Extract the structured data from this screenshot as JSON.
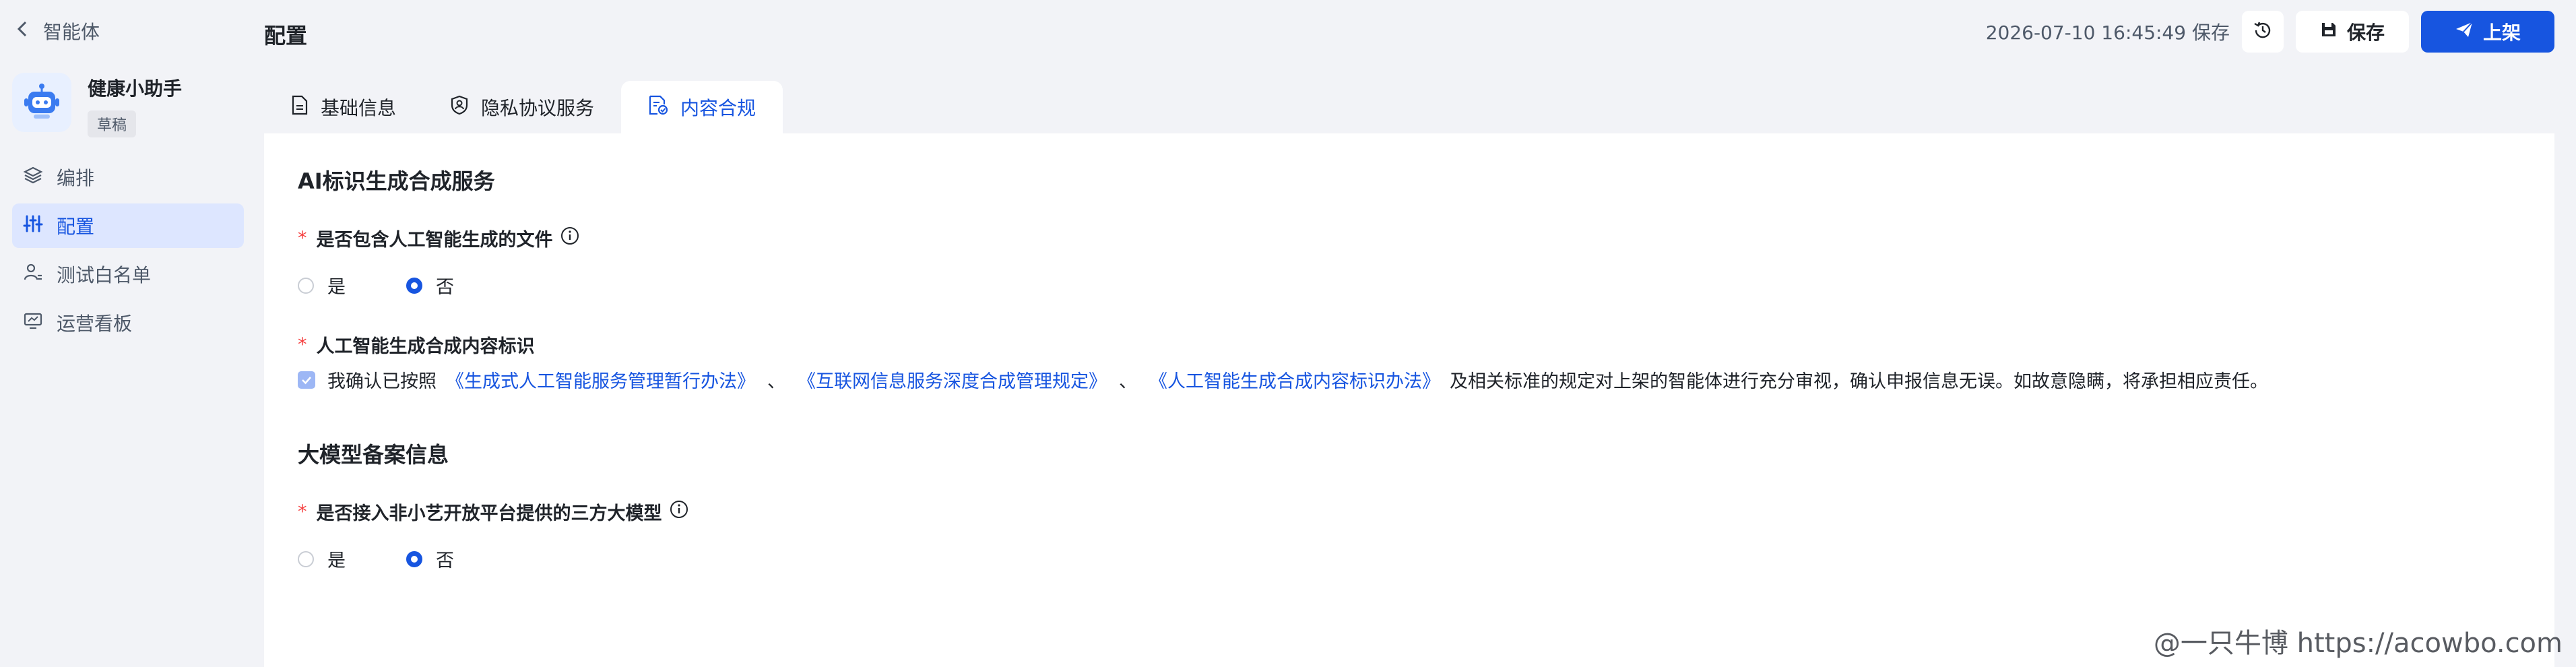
{
  "sidebar": {
    "back_label": "智能体",
    "agent": {
      "name": "健康小助手",
      "status": "草稿"
    },
    "items": [
      {
        "label": "编排",
        "icon": "layers-icon",
        "active": false
      },
      {
        "label": "配置",
        "icon": "sliders-icon",
        "active": true
      },
      {
        "label": "测试白名单",
        "icon": "user-list-icon",
        "active": false
      },
      {
        "label": "运营看板",
        "icon": "monitor-icon",
        "active": false
      }
    ]
  },
  "header": {
    "title": "配置",
    "saved_at": "2026-07-10 16:45:49 保存",
    "save_label": "保存",
    "publish_label": "上架"
  },
  "tabs": [
    {
      "label": "基础信息",
      "active": false
    },
    {
      "label": "隐私协议服务",
      "active": false
    },
    {
      "label": "内容合规",
      "active": true
    }
  ],
  "content": {
    "section1": {
      "title": "AI标识生成合成服务",
      "q1": {
        "required": "*",
        "label": "是否包含人工智能生成的文件",
        "options": [
          "是",
          "否"
        ],
        "selected": "否"
      },
      "q2": {
        "required": "*",
        "label": "人工智能生成合成内容标识",
        "checked": true,
        "text_prefix": "我确认已按照",
        "links": [
          "《生成式人工智能服务管理暂行办法》",
          "《互联网信息服务深度合成管理规定》",
          "《人工智能生成合成内容标识办法》"
        ],
        "separator": "、",
        "text_suffix": "及相关标准的规定对上架的智能体进行充分审视，确认申报信息无误。如故意隐瞒，将承担相应责任。"
      }
    },
    "section2": {
      "title": "大模型备案信息",
      "q1": {
        "required": "*",
        "label": "是否接入非小艺开放平台提供的三方大模型",
        "options": [
          "是",
          "否"
        ],
        "selected": "否"
      }
    }
  },
  "watermark": "@一只牛博 https://acowbo.com",
  "colors": {
    "accent": "#1755e0",
    "active_nav_bg": "#dde6ff",
    "required": "#f53f3f",
    "page_bg": "#f2f3f7"
  }
}
